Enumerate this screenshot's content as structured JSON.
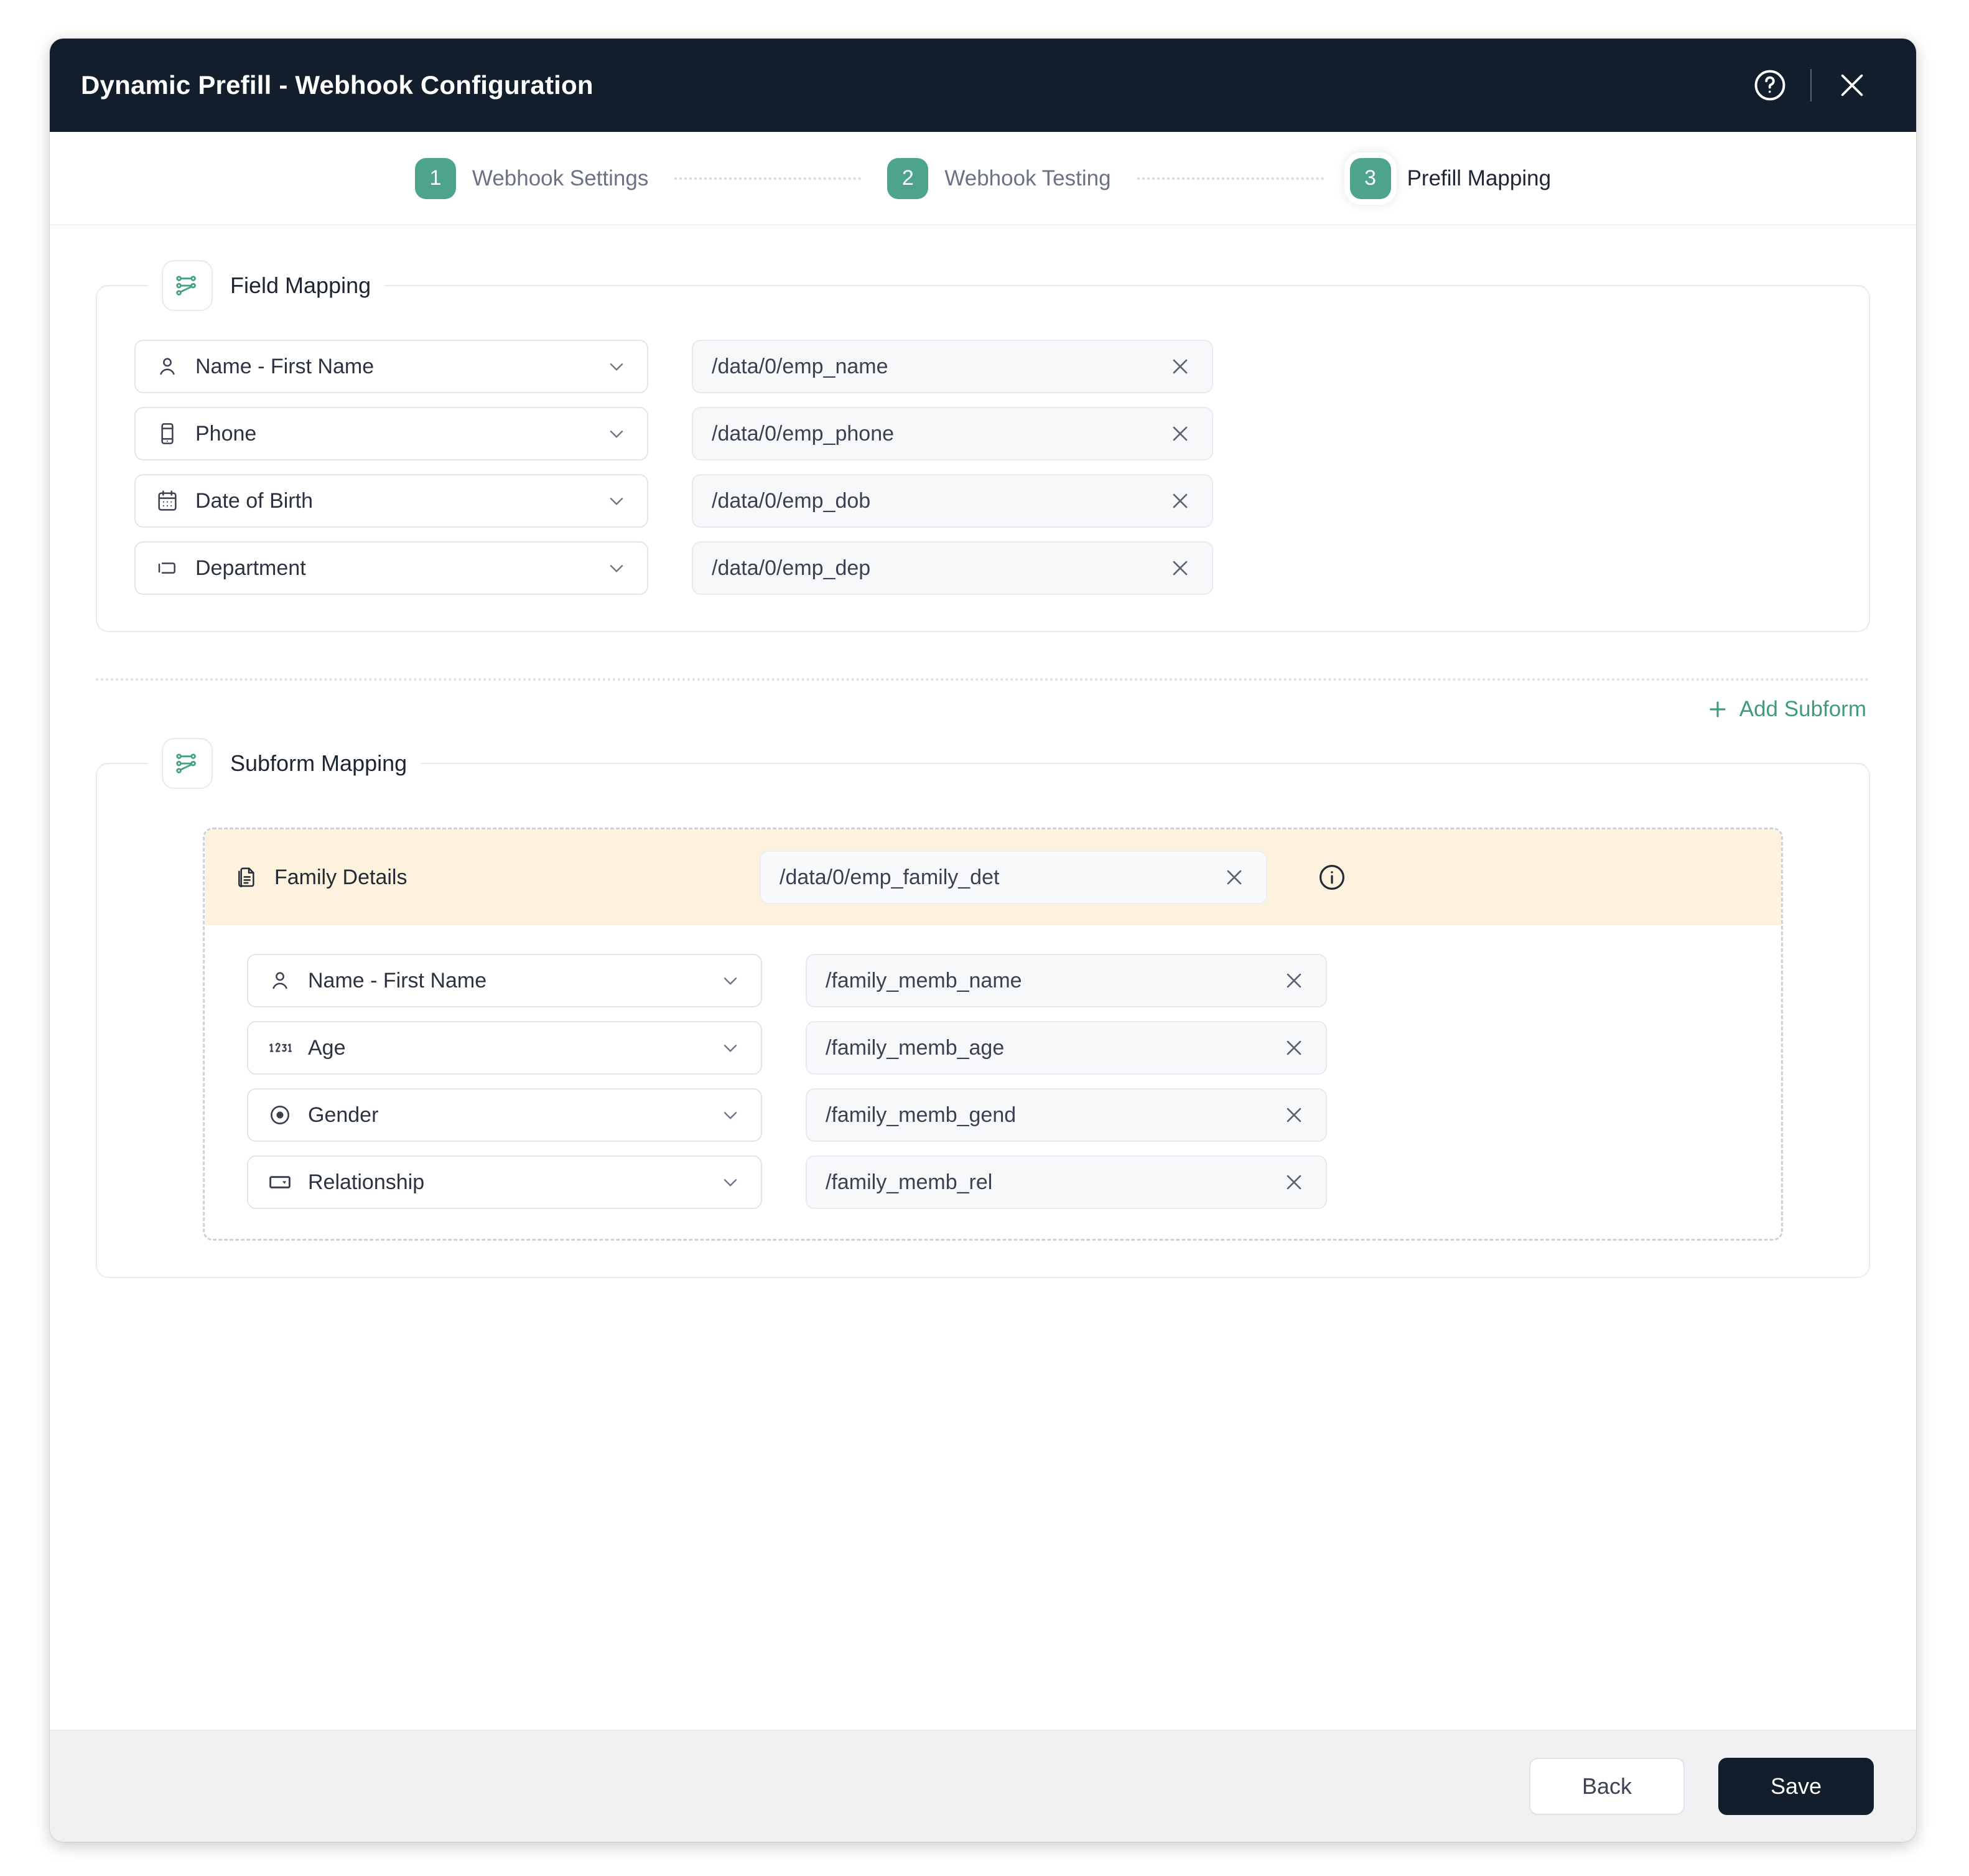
{
  "header": {
    "title": "Dynamic Prefill - Webhook Configuration",
    "help_icon": "help-circle-icon",
    "close_icon": "close-icon"
  },
  "stepper": {
    "steps": [
      {
        "number": "1",
        "label": "Webhook Settings",
        "active": false
      },
      {
        "number": "2",
        "label": "Webhook Testing",
        "active": false
      },
      {
        "number": "3",
        "label": "Prefill Mapping",
        "active": true
      }
    ],
    "accent_color": "#4ea38c"
  },
  "field_mapping": {
    "legend": "Field Mapping",
    "legend_icon": "mapping-nodes-icon",
    "rows": [
      {
        "field": "Name - First Name",
        "icon": "person-icon",
        "path": "/data/0/emp_name"
      },
      {
        "field": "Phone",
        "icon": "phone-icon",
        "path": "/data/0/emp_phone"
      },
      {
        "field": "Date of Birth",
        "icon": "calendar-icon",
        "path": "/data/0/emp_dob"
      },
      {
        "field": "Department",
        "icon": "text-field-icon",
        "path": "/data/0/emp_dep"
      }
    ]
  },
  "subform_mapping": {
    "legend": "Subform Mapping",
    "legend_icon": "mapping-nodes-icon",
    "add_label": "Add Subform",
    "add_icon": "plus-icon",
    "subform": {
      "title": "Family Details",
      "title_icon": "document-icon",
      "path": "/data/0/emp_family_det",
      "info_icon": "info-circle-icon",
      "header_color": "#fdf2dd",
      "rows": [
        {
          "field": "Name - First Name",
          "icon": "person-icon",
          "path": "/family_memb_name"
        },
        {
          "field": "Age",
          "icon": "number-123-icon",
          "path": "/family_memb_age"
        },
        {
          "field": "Gender",
          "icon": "radio-button-icon",
          "path": "/family_memb_gend"
        },
        {
          "field": "Relationship",
          "icon": "dropdown-select-icon",
          "path": "/family_memb_rel"
        }
      ]
    }
  },
  "footer": {
    "back_label": "Back",
    "save_label": "Save"
  }
}
